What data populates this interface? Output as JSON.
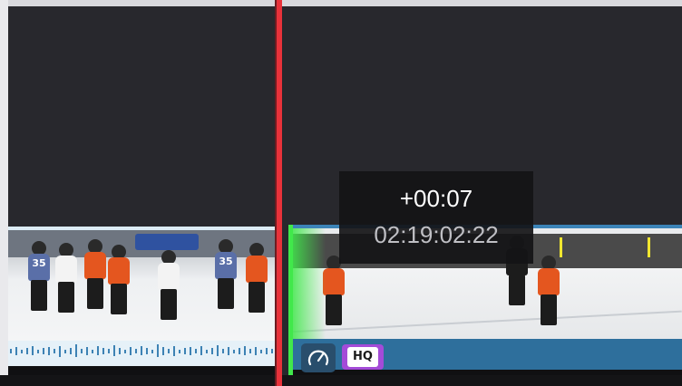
{
  "timeline": {
    "tooltip": {
      "offset": "+00:07",
      "timecode": "02:19:02:22"
    },
    "clip_right": {
      "badges": {
        "speed_icon": "speedometer-icon",
        "quality_label": "HQ"
      }
    },
    "clip_left": {
      "jersey_numbers": [
        "35",
        "35"
      ]
    }
  },
  "colors": {
    "playhead": "#e8323a",
    "trim_handle": "#41e84b",
    "clip_selected": "#2f6f9a",
    "marker": "#f1e630",
    "quality_badge": "#a44bd8"
  }
}
